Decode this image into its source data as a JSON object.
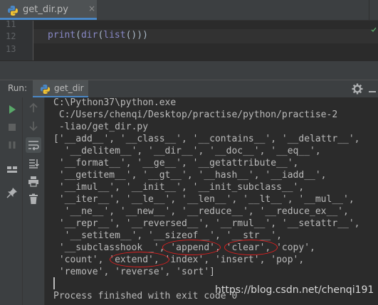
{
  "editor": {
    "tab_label": "get_dir.py",
    "tab_close": "×",
    "line_numbers": [
      "11",
      "12",
      "13"
    ],
    "code": {
      "print": "print",
      "open1": "(",
      "dir": "dir",
      "open2": "(",
      "list": "list",
      "close": "()))"
    }
  },
  "run_panel": {
    "label": "Run:",
    "tab_label": "get_dir",
    "icons": [
      "run-icon",
      "stop-icon",
      "pause-icon",
      "layout-icon",
      "pin-icon",
      "up-arrow-icon",
      "down-arrow-icon",
      "soft-wrap-icon",
      "scroll-to-end-icon",
      "print-icon",
      "trash-icon",
      "gear-icon",
      "hide-icon"
    ]
  },
  "console": {
    "lines": [
      "C:\\Python37\\python.exe",
      " C:/Users/chenqi/Desktop/practise/python/practise-2",
      " -liao/get_dir.py",
      "['__add__', '__class__', '__contains__', '__delattr__',",
      "  '__delitem__', '__dir__', '__doc__', '__eq__',",
      " '__format__', '__ge__', '__getattribute__',",
      " '__getitem__', '__gt__', '__hash__', '__iadd__',",
      " '__imul__', '__init__', '__init_subclass__',",
      " '__iter__', '__le__', '__len__', '__lt__', '__mul__',",
      "  '__ne__', '__new__', '__reduce__', '__reduce_ex__',",
      " '__repr__', '__reversed__', '__rmul__', '__setattr__',",
      "  '__setitem__', '__sizeof__', '__str__',",
      " '__subclasshook__', 'append', 'clear', 'copy',",
      " 'count', 'extend', 'index', 'insert', 'pop',",
      " 'remove', 'reverse', 'sort']",
      "",
      "Process finished with exit code 0"
    ]
  },
  "watermark": "https://blog.csdn.net/chenqi191",
  "colors": {
    "accent": "#4a88c7",
    "highlight_ring": "#e02020",
    "run_green": "#59a869"
  }
}
